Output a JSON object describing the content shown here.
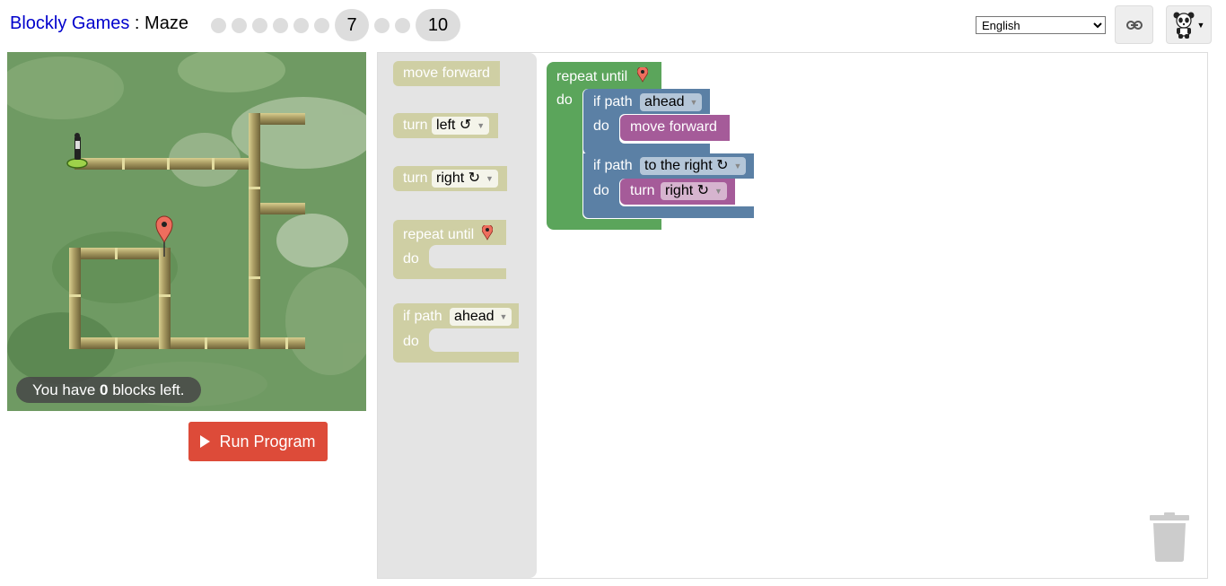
{
  "header": {
    "app_link": "Blockly Games",
    "separator": " : ",
    "game_name": "Maze",
    "current_level": "7",
    "last_level": "10",
    "language": "English"
  },
  "maze": {
    "capacity_prefix": "You have ",
    "capacity_count": "0",
    "capacity_suffix": " blocks left."
  },
  "run_button": {
    "label": "Run Program"
  },
  "toolbox": {
    "move_forward": "move forward",
    "turn": "turn",
    "left": "left ↺",
    "right": "right ↻",
    "repeat_until": "repeat until",
    "do": "do",
    "if_path": "if path",
    "ahead": "ahead"
  },
  "program": {
    "repeat_until": "repeat until",
    "do": "do",
    "if1_label": "if path",
    "if1_dir": "ahead",
    "if1_do": "do",
    "move_forward": "move forward",
    "if2_label": "if path",
    "if2_dir": "to the right ↻",
    "if2_do": "do",
    "turn": "turn",
    "turn_dir": "right ↻"
  },
  "colors": {
    "repeat_block": "#5ba55b",
    "if_block": "#5b80a5",
    "action_block": "#a55b99",
    "flyout_block": "#cfcfa4",
    "run_button": "#dd4b39",
    "link": "#0000cc"
  }
}
